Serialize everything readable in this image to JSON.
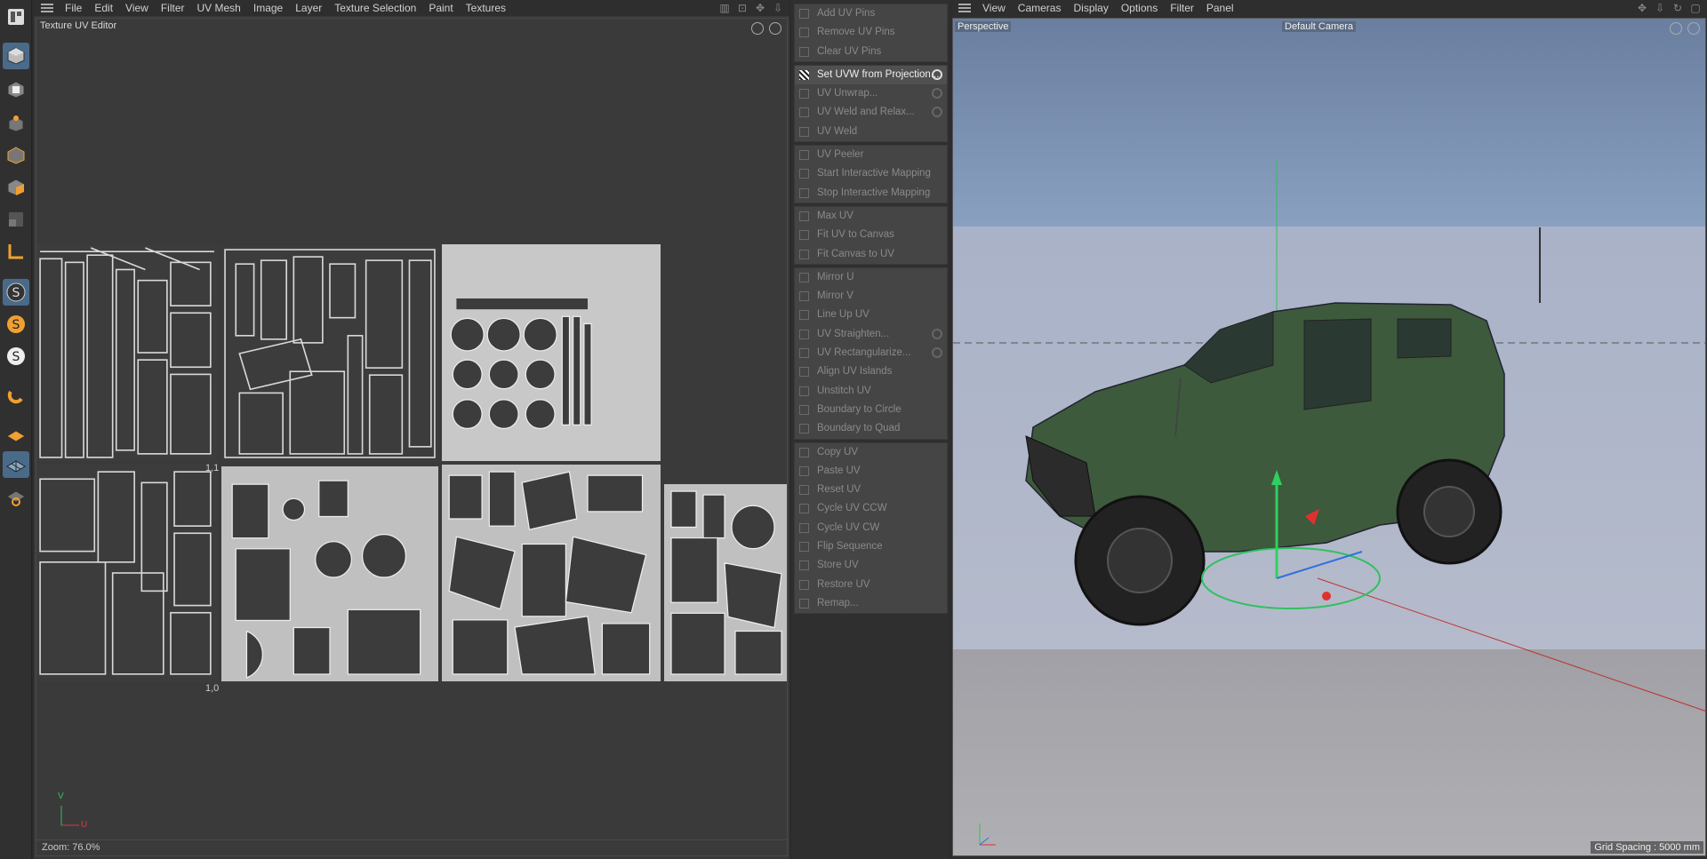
{
  "uv_editor": {
    "menu": [
      "File",
      "Edit",
      "View",
      "Filter",
      "UV Mesh",
      "Image",
      "Layer",
      "Texture Selection",
      "Paint",
      "Textures"
    ],
    "title": "Texture UV Editor",
    "corner_label_top": "1,1",
    "corner_label_bottom": "1,0",
    "axis_v": "V",
    "axis_u": "U",
    "zoom": "Zoom: 76.0%"
  },
  "commands": {
    "groups": [
      {
        "items": [
          {
            "label": "Add UV Pins",
            "enabled": false,
            "gear": false
          },
          {
            "label": "Remove UV Pins",
            "enabled": false,
            "gear": false
          },
          {
            "label": "Clear UV Pins",
            "enabled": false,
            "gear": false
          }
        ]
      },
      {
        "items": [
          {
            "label": "Set UVW from Projection...",
            "enabled": true,
            "gear": true
          },
          {
            "label": "UV Unwrap...",
            "enabled": false,
            "gear": true
          },
          {
            "label": "UV Weld and Relax...",
            "enabled": false,
            "gear": true
          },
          {
            "label": "UV Weld",
            "enabled": false,
            "gear": false
          }
        ]
      },
      {
        "items": [
          {
            "label": "UV Peeler",
            "enabled": false,
            "gear": false
          },
          {
            "label": "Start Interactive Mapping",
            "enabled": false,
            "gear": false
          },
          {
            "label": "Stop Interactive Mapping",
            "enabled": false,
            "gear": false
          }
        ]
      },
      {
        "items": [
          {
            "label": "Max UV",
            "enabled": false,
            "gear": false
          },
          {
            "label": "Fit UV to Canvas",
            "enabled": false,
            "gear": false
          },
          {
            "label": "Fit Canvas to UV",
            "enabled": false,
            "gear": false
          }
        ]
      },
      {
        "items": [
          {
            "label": "Mirror U",
            "enabled": false,
            "gear": false
          },
          {
            "label": "Mirror V",
            "enabled": false,
            "gear": false
          },
          {
            "label": "Line Up UV",
            "enabled": false,
            "gear": false
          },
          {
            "label": "UV Straighten...",
            "enabled": false,
            "gear": true
          },
          {
            "label": "UV Rectangularize...",
            "enabled": false,
            "gear": true
          },
          {
            "label": "Align UV Islands",
            "enabled": false,
            "gear": false
          },
          {
            "label": "Unstitch UV",
            "enabled": false,
            "gear": false
          },
          {
            "label": "Boundary to Circle",
            "enabled": false,
            "gear": false
          },
          {
            "label": "Boundary to Quad",
            "enabled": false,
            "gear": false
          }
        ]
      },
      {
        "items": [
          {
            "label": "Copy UV",
            "enabled": false,
            "gear": false
          },
          {
            "label": "Paste UV",
            "enabled": false,
            "gear": false
          },
          {
            "label": "Reset UV",
            "enabled": false,
            "gear": false
          },
          {
            "label": "Cycle UV CCW",
            "enabled": false,
            "gear": false
          },
          {
            "label": "Cycle UV CW",
            "enabled": false,
            "gear": false
          },
          {
            "label": "Flip Sequence",
            "enabled": false,
            "gear": false
          },
          {
            "label": "Store UV",
            "enabled": false,
            "gear": false
          },
          {
            "label": "Restore UV",
            "enabled": false,
            "gear": false
          },
          {
            "label": "Remap...",
            "enabled": false,
            "gear": false
          }
        ]
      }
    ]
  },
  "viewport": {
    "menu": [
      "View",
      "Cameras",
      "Display",
      "Options",
      "Filter",
      "Panel"
    ],
    "mode_label": "Perspective",
    "camera_label": "Default Camera",
    "grid_spacing": "Grid Spacing : 5000 mm"
  },
  "colors": {
    "vehicle_body": "#3e5a3c",
    "axis_x": "#e03030",
    "axis_y": "#30d060",
    "axis_z": "#3070e0"
  }
}
